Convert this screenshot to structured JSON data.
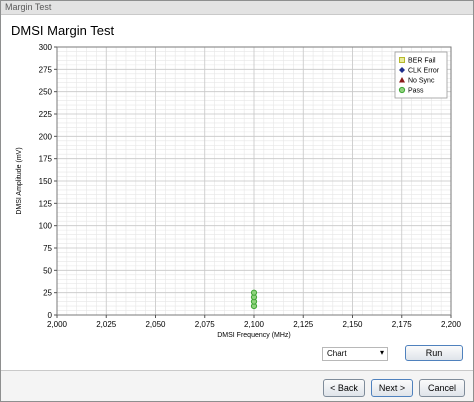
{
  "window": {
    "title": "Margin Test"
  },
  "panel": {
    "title": "DMSI Margin Test"
  },
  "chart_data": {
    "type": "scatter",
    "xlabel": "DMSI Frequency (MHz)",
    "ylabel": "DMSI Amplitude (mV)",
    "xlim": [
      2000,
      2200
    ],
    "ylim": [
      0,
      300
    ],
    "x_ticks": [
      "2,000",
      "2,025",
      "2,050",
      "2,075",
      "2,100",
      "2,125",
      "2,150",
      "2,175",
      "2,200"
    ],
    "y_ticks": [
      "0",
      "25",
      "50",
      "75",
      "100",
      "125",
      "150",
      "175",
      "200",
      "225",
      "250",
      "275",
      "300"
    ],
    "grid": true,
    "legend_position": "top-right",
    "legend": [
      {
        "label": "BER Fail",
        "marker": "square",
        "color": "#b5b82c"
      },
      {
        "label": "CLK Error",
        "marker": "diamond",
        "color": "#1f2f8c"
      },
      {
        "label": "No Sync",
        "marker": "triangle",
        "color": "#8b1a1a"
      },
      {
        "label": "Pass",
        "marker": "circle",
        "color": "#3fa535"
      }
    ],
    "series": [
      {
        "name": "Pass",
        "points": [
          {
            "x": 2100,
            "y": 10
          },
          {
            "x": 2100,
            "y": 15
          },
          {
            "x": 2100,
            "y": 20
          },
          {
            "x": 2100,
            "y": 25
          }
        ]
      }
    ]
  },
  "controls": {
    "view_select": "Chart",
    "run_label": "Run"
  },
  "footer": {
    "back_label": "< Back",
    "next_label": "Next >",
    "cancel_label": "Cancel"
  }
}
